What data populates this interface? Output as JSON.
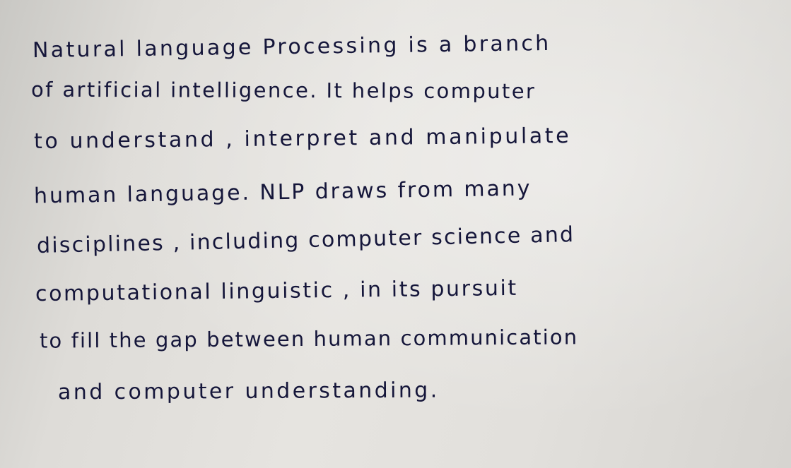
{
  "document": {
    "lines": [
      "Natural language Processing is a branch",
      "of artificial intelligence. It helps computer",
      "to understand , interpret and manipulate",
      "human language. NLP draws from many",
      "disciplines , including computer science and",
      "computational linguistic , in its pursuit",
      "to fill the gap between human communication",
      "and computer understanding."
    ]
  }
}
